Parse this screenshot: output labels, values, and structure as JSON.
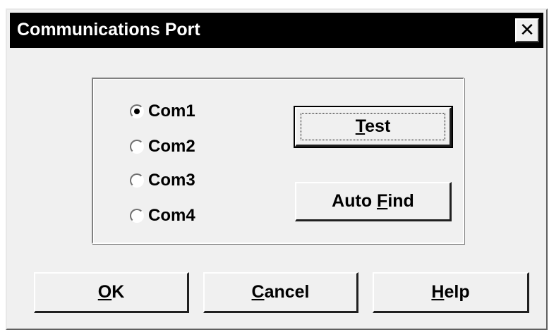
{
  "window": {
    "title": "Communications Port",
    "close_label": "✕"
  },
  "com_ports": [
    {
      "label_pre": "",
      "label_u": "",
      "label_post": "Com1",
      "selected": true
    },
    {
      "label_pre": "",
      "label_u": "",
      "label_post": "Com2",
      "selected": false
    },
    {
      "label_pre": "",
      "label_u": "",
      "label_post": "Com3",
      "selected": false
    },
    {
      "label_pre": "",
      "label_u": "",
      "label_post": "Com4",
      "selected": false
    }
  ],
  "buttons": {
    "test": {
      "pre": "",
      "u": "T",
      "post": "est"
    },
    "auto_find": {
      "pre": "Auto ",
      "u": "F",
      "post": "ind"
    },
    "ok": {
      "pre": "",
      "u": "O",
      "post": "K"
    },
    "cancel": {
      "pre": "",
      "u": "C",
      "post": "ancel"
    },
    "help": {
      "pre": "",
      "u": "H",
      "post": "elp"
    }
  },
  "icons": {
    "close": "close-icon",
    "radio_selected": "radio-selected-icon",
    "radio_unselected": "radio-unselected-icon"
  },
  "colors": {
    "titlebar": "#000000",
    "dialog_bg": "#f0f0f0"
  }
}
